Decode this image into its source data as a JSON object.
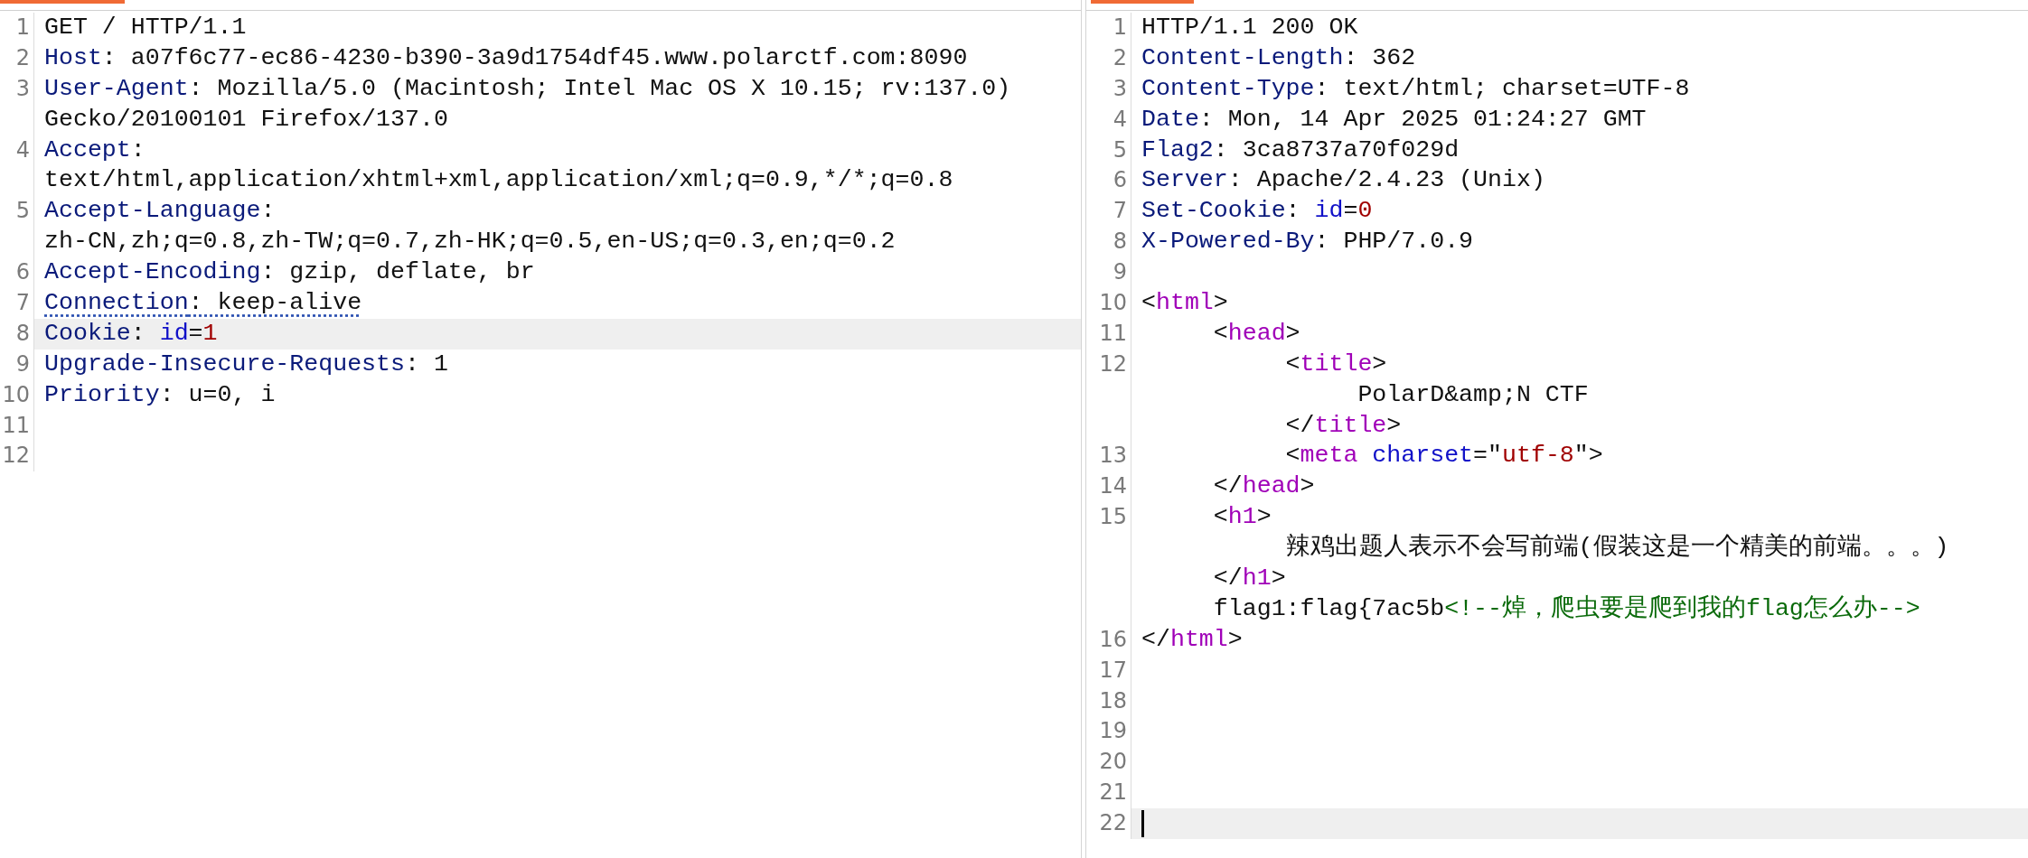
{
  "panes": [
    {
      "lines": [
        {
          "number": "1",
          "current": false,
          "cursor": false,
          "parts": [
            {
              "tokens": [
                {
                  "kind": "plain",
                  "text": "GET / HTTP/1.1"
                }
              ]
            }
          ]
        },
        {
          "number": "2",
          "current": false,
          "cursor": false,
          "parts": [
            {
              "tokens": [
                {
                  "kind": "name",
                  "text": "Host"
                },
                {
                  "kind": "plain",
                  "text": ": a07f6c77-ec86-4230-b390-3a9d1754df45.www.polarctf.com:8090"
                }
              ]
            }
          ]
        },
        {
          "number": "3",
          "current": false,
          "cursor": false,
          "parts": [
            {
              "tokens": [
                {
                  "kind": "name",
                  "text": "User-Agent"
                },
                {
                  "kind": "plain",
                  "text": ": Mozilla/5.0 (Macintosh; Intel Mac OS X 10.15; rv:137.0)"
                }
              ]
            },
            {
              "tokens": [
                {
                  "kind": "plain",
                  "text": "Gecko/20100101 Firefox/137.0"
                }
              ]
            }
          ]
        },
        {
          "number": "4",
          "current": false,
          "cursor": false,
          "parts": [
            {
              "tokens": [
                {
                  "kind": "name",
                  "text": "Accept"
                },
                {
                  "kind": "plain",
                  "text": ":"
                }
              ]
            },
            {
              "tokens": [
                {
                  "kind": "plain",
                  "text": "text/html,application/xhtml+xml,application/xml;q=0.9,*/*;q=0.8"
                }
              ]
            }
          ]
        },
        {
          "number": "5",
          "current": false,
          "cursor": false,
          "parts": [
            {
              "tokens": [
                {
                  "kind": "name",
                  "text": "Accept-Language"
                },
                {
                  "kind": "plain",
                  "text": ":"
                }
              ]
            },
            {
              "tokens": [
                {
                  "kind": "plain",
                  "text": "zh-CN,zh;q=0.8,zh-TW;q=0.7,zh-HK;q=0.5,en-US;q=0.3,en;q=0.2"
                }
              ]
            }
          ]
        },
        {
          "number": "6",
          "current": false,
          "cursor": false,
          "parts": [
            {
              "tokens": [
                {
                  "kind": "name",
                  "text": "Accept-Encoding"
                },
                {
                  "kind": "plain",
                  "text": ": gzip, deflate, br"
                }
              ]
            }
          ]
        },
        {
          "number": "7",
          "current": false,
          "cursor": false,
          "parts": [
            {
              "tokens": [
                {
                  "kind": "name",
                  "text": "Connection",
                  "dotted": true
                },
                {
                  "kind": "plain",
                  "text": ": keep-alive",
                  "dotted": true
                }
              ]
            }
          ]
        },
        {
          "number": "8",
          "current": true,
          "cursor": false,
          "parts": [
            {
              "tokens": [
                {
                  "kind": "name",
                  "text": "Cookie"
                },
                {
                  "kind": "plain",
                  "text": ": "
                },
                {
                  "kind": "attr",
                  "text": "id"
                },
                {
                  "kind": "plain",
                  "text": "="
                },
                {
                  "kind": "value",
                  "text": "1"
                }
              ]
            }
          ]
        },
        {
          "number": "9",
          "current": false,
          "cursor": false,
          "parts": [
            {
              "tokens": [
                {
                  "kind": "name",
                  "text": "Upgrade-Insecure-Requests"
                },
                {
                  "kind": "plain",
                  "text": ": 1"
                }
              ]
            }
          ]
        },
        {
          "number": "10",
          "current": false,
          "cursor": false,
          "parts": [
            {
              "tokens": [
                {
                  "kind": "name",
                  "text": "Priority"
                },
                {
                  "kind": "plain",
                  "text": ": u=0, i"
                }
              ]
            }
          ]
        },
        {
          "number": "11",
          "current": false,
          "cursor": false
        },
        {
          "number": "12",
          "current": false,
          "cursor": false
        }
      ]
    },
    {
      "lines": [
        {
          "number": "1",
          "current": false,
          "cursor": false,
          "parts": [
            {
              "tokens": [
                {
                  "kind": "plain",
                  "text": "HTTP/1.1 200 OK"
                }
              ]
            }
          ]
        },
        {
          "number": "2",
          "current": false,
          "cursor": false,
          "parts": [
            {
              "tokens": [
                {
                  "kind": "name",
                  "text": "Content-Length"
                },
                {
                  "kind": "plain",
                  "text": ": 362"
                }
              ]
            }
          ]
        },
        {
          "number": "3",
          "current": false,
          "cursor": false,
          "parts": [
            {
              "tokens": [
                {
                  "kind": "name",
                  "text": "Content-Type"
                },
                {
                  "kind": "plain",
                  "text": ": text/html; charset=UTF-8"
                }
              ]
            }
          ]
        },
        {
          "number": "4",
          "current": false,
          "cursor": false,
          "parts": [
            {
              "tokens": [
                {
                  "kind": "name",
                  "text": "Date"
                },
                {
                  "kind": "plain",
                  "text": ": Mon, 14 Apr 2025 01:24:27 GMT"
                }
              ]
            }
          ]
        },
        {
          "number": "5",
          "current": false,
          "cursor": false,
          "parts": [
            {
              "tokens": [
                {
                  "kind": "name",
                  "text": "Flag2"
                },
                {
                  "kind": "plain",
                  "text": ": 3ca8737a70f029d"
                }
              ]
            }
          ]
        },
        {
          "number": "6",
          "current": false,
          "cursor": false,
          "parts": [
            {
              "tokens": [
                {
                  "kind": "name",
                  "text": "Server"
                },
                {
                  "kind": "plain",
                  "text": ": Apache/2.4.23 (Unix)"
                }
              ]
            }
          ]
        },
        {
          "number": "7",
          "current": false,
          "cursor": false,
          "parts": [
            {
              "tokens": [
                {
                  "kind": "name",
                  "text": "Set-Cookie"
                },
                {
                  "kind": "plain",
                  "text": ": "
                },
                {
                  "kind": "attr",
                  "text": "id"
                },
                {
                  "kind": "plain",
                  "text": "="
                },
                {
                  "kind": "value",
                  "text": "0"
                }
              ]
            }
          ]
        },
        {
          "number": "8",
          "current": false,
          "cursor": false,
          "parts": [
            {
              "tokens": [
                {
                  "kind": "name",
                  "text": "X-Powered-By"
                },
                {
                  "kind": "plain",
                  "text": ": PHP/7.0.9"
                }
              ]
            }
          ]
        },
        {
          "number": "9",
          "current": false,
          "cursor": false
        },
        {
          "number": "10",
          "current": false,
          "cursor": false,
          "parts": [
            {
              "tokens": [
                {
                  "kind": "plain",
                  "text": "<"
                },
                {
                  "kind": "tag",
                  "text": "html"
                },
                {
                  "kind": "plain",
                  "text": ">"
                }
              ]
            }
          ]
        },
        {
          "number": "11",
          "current": false,
          "cursor": false,
          "parts": [
            {
              "tokens": [
                {
                  "kind": "plain",
                  "text": "\t<"
                },
                {
                  "kind": "tag",
                  "text": "head"
                },
                {
                  "kind": "plain",
                  "text": ">"
                }
              ]
            }
          ]
        },
        {
          "number": "12",
          "current": false,
          "cursor": false,
          "parts": [
            {
              "tokens": [
                {
                  "kind": "plain",
                  "text": "\t\t<"
                },
                {
                  "kind": "tag",
                  "text": "title"
                },
                {
                  "kind": "plain",
                  "text": ">"
                }
              ]
            },
            {
              "tokens": [
                {
                  "kind": "plain",
                  "text": "\t\t\tPolarD&amp;N CTF"
                }
              ]
            },
            {
              "tokens": [
                {
                  "kind": "plain",
                  "text": "\t\t</"
                },
                {
                  "kind": "tag",
                  "text": "title"
                },
                {
                  "kind": "plain",
                  "text": ">"
                }
              ]
            }
          ]
        },
        {
          "number": "13",
          "current": false,
          "cursor": false,
          "parts": [
            {
              "tokens": [
                {
                  "kind": "plain",
                  "text": "\t\t<"
                },
                {
                  "kind": "tag",
                  "text": "meta"
                },
                {
                  "kind": "attr",
                  "text": " charset"
                },
                {
                  "kind": "plain",
                  "text": "=\""
                },
                {
                  "kind": "value",
                  "text": "utf-8"
                },
                {
                  "kind": "plain",
                  "text": "\">"
                }
              ]
            }
          ]
        },
        {
          "number": "14",
          "current": false,
          "cursor": false,
          "parts": [
            {
              "tokens": [
                {
                  "kind": "plain",
                  "text": "\t</"
                },
                {
                  "kind": "tag",
                  "text": "head"
                },
                {
                  "kind": "plain",
                  "text": ">"
                }
              ]
            }
          ]
        },
        {
          "number": "15",
          "current": false,
          "cursor": false,
          "parts": [
            {
              "tokens": [
                {
                  "kind": "plain",
                  "text": "\t<"
                },
                {
                  "kind": "tag",
                  "text": "h1"
                },
                {
                  "kind": "plain",
                  "text": ">"
                }
              ]
            },
            {
              "tokens": [
                {
                  "kind": "plain",
                  "text": "\t\t辣鸡出题人表示不会写前端(假装这是一个精美的前端。。。)"
                }
              ]
            },
            {
              "tokens": [
                {
                  "kind": "plain",
                  "text": "\t</"
                },
                {
                  "kind": "tag",
                  "text": "h1"
                },
                {
                  "kind": "plain",
                  "text": ">"
                }
              ]
            },
            {
              "tokens": [
                {
                  "kind": "plain",
                  "text": "\tflag1:flag{7ac5b"
                },
                {
                  "kind": "comment",
                  "text": "<!--焯，爬虫要是爬到我的flag怎么办-->"
                }
              ]
            }
          ]
        },
        {
          "number": "16",
          "current": false,
          "cursor": false,
          "parts": [
            {
              "tokens": [
                {
                  "kind": "plain",
                  "text": "</"
                },
                {
                  "kind": "tag",
                  "text": "html"
                },
                {
                  "kind": "plain",
                  "text": ">"
                }
              ]
            }
          ]
        },
        {
          "number": "17",
          "current": false,
          "cursor": false
        },
        {
          "number": "18",
          "current": false,
          "cursor": false
        },
        {
          "number": "19",
          "current": false,
          "cursor": false
        },
        {
          "number": "20",
          "current": false,
          "cursor": false
        },
        {
          "number": "21",
          "current": false,
          "cursor": false
        },
        {
          "number": "22",
          "current": true,
          "cursor": true
        }
      ]
    }
  ]
}
